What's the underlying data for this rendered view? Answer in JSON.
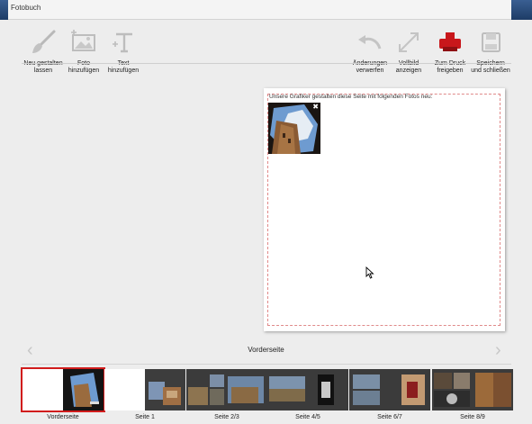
{
  "window": {
    "title": "Fotobuch"
  },
  "toolbar": {
    "redesign": {
      "label": "Neu gestalten\nlassen",
      "icon": "brush-icon"
    },
    "add_photo": {
      "label": "Foto\nhinzufügen",
      "icon": "photo-add-icon"
    },
    "add_text": {
      "label": "Text\nhinzufügen",
      "icon": "text-add-icon"
    },
    "discard": {
      "label": "Änderungen\nverwerfen",
      "icon": "undo-icon"
    },
    "fullscreen": {
      "label": "Vollbild\nanzeigen",
      "icon": "fullscreen-icon"
    },
    "print": {
      "label": "Zum Druck\nfreigeben",
      "icon": "printer-icon"
    },
    "save": {
      "label": "Speichern\nund schließen",
      "icon": "save-icon"
    }
  },
  "page": {
    "note": "Unsere Grafiker gestalten diese Seite mit folgenden Fotos neu:",
    "photo_close": "✖"
  },
  "navigation": {
    "current": "Vorderseite",
    "prev": "‹",
    "next": "›"
  },
  "thumbnails": [
    {
      "label": "Vorderseite",
      "selected": true
    },
    {
      "label": "Seite 1",
      "selected": false
    },
    {
      "label": "Seite 2/3",
      "selected": false
    },
    {
      "label": "Seite 4/5",
      "selected": false
    },
    {
      "label": "Seite 6/7",
      "selected": false
    },
    {
      "label": "Seite 8/9",
      "selected": false
    }
  ],
  "colors": {
    "accent": "#d11c1c",
    "title_edge": "#2a4d7e",
    "print_icon": "#c8171b"
  }
}
